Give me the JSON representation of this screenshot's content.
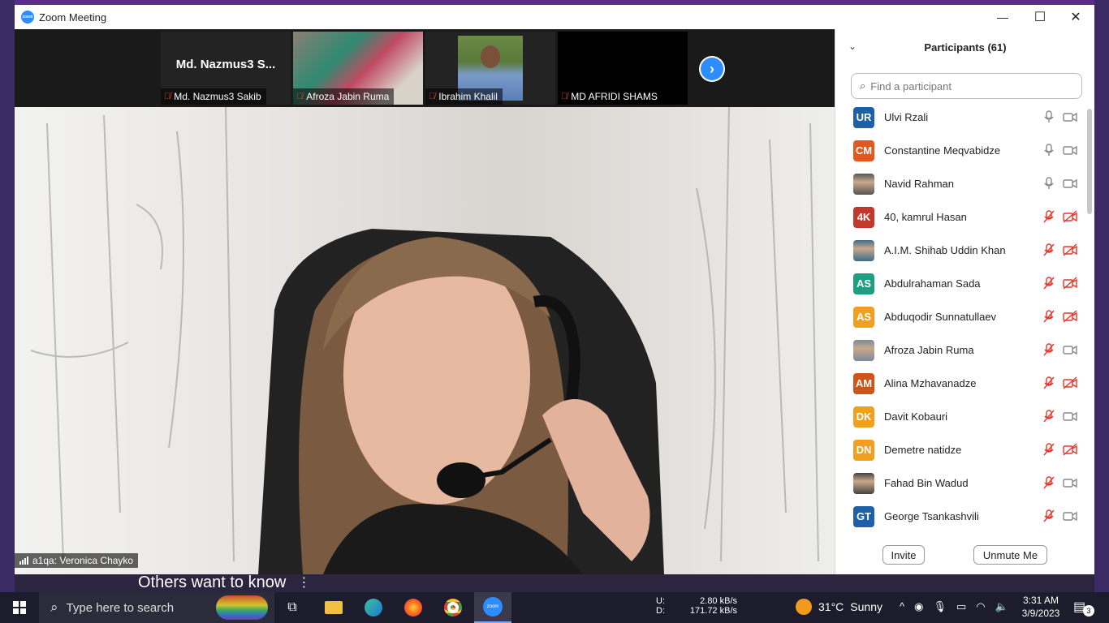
{
  "window": {
    "title": "Zoom Meeting",
    "controls": {
      "minimize": "—",
      "maximize": "☐",
      "close": "✕"
    }
  },
  "thumbnails": [
    {
      "name": "Md. Nazmus3 Sakib",
      "big_name": "Md. Nazmus3  S...",
      "muted": true
    },
    {
      "name": "Afroza Jabin Ruma",
      "muted": true
    },
    {
      "name": "Ibrahim Khalil",
      "muted": true
    },
    {
      "name": "MD AFRIDI SHAMS",
      "muted": true
    }
  ],
  "main_speaker": {
    "label": "a1qa: Veronica Chayko"
  },
  "participants_panel": {
    "title": "Participants (61)",
    "search_placeholder": "Find a participant",
    "participants": [
      {
        "initials": "UR",
        "name": "Ulvi Rzali",
        "color": "#1d5fa8",
        "mic": "on",
        "video": "on"
      },
      {
        "initials": "CM",
        "name": "Constantine Meqvabidze",
        "color": "#e05a1e",
        "mic": "on",
        "video": "on"
      },
      {
        "initials": "",
        "name": "Navid Rahman",
        "color": "#555555",
        "mic": "on",
        "video": "on",
        "photo": true
      },
      {
        "initials": "4K",
        "name": "40, kamrul Hasan",
        "color": "#c23a2b",
        "mic": "muted",
        "video": "off"
      },
      {
        "initials": "",
        "name": "A.I.M. Shihab Uddin Khan",
        "color": "#3a6b8c",
        "mic": "muted",
        "video": "off",
        "photo": true
      },
      {
        "initials": "AS",
        "name": "Abdulrahaman Sada",
        "color": "#1f9e84",
        "mic": "muted",
        "video": "off"
      },
      {
        "initials": "AS",
        "name": "Abduqodir Sunnatullaev",
        "color": "#f0a01e",
        "mic": "muted",
        "video": "off"
      },
      {
        "initials": "",
        "name": "Afroza Jabin Ruma",
        "color": "#7a8a9a",
        "mic": "muted",
        "video": "on",
        "photo": true
      },
      {
        "initials": "AM",
        "name": "Alina Mzhavanadze",
        "color": "#d0541a",
        "mic": "muted",
        "video": "off"
      },
      {
        "initials": "DK",
        "name": "Davit Kobauri",
        "color": "#f0a01e",
        "mic": "muted",
        "video": "on"
      },
      {
        "initials": "DN",
        "name": "Demetre natidze",
        "color": "#f0a01e",
        "mic": "muted",
        "video": "off"
      },
      {
        "initials": "",
        "name": "Fahad Bin Wadud",
        "color": "#444444",
        "mic": "muted",
        "video": "on",
        "photo": true
      },
      {
        "initials": "GT",
        "name": "George Tsankashvili",
        "color": "#1d5fa8",
        "mic": "muted",
        "video": "on"
      }
    ],
    "invite_label": "Invite",
    "unmute_label": "Unmute Me"
  },
  "news": {
    "text": "Others want to know",
    "menu": "⋮"
  },
  "taskbar": {
    "search_placeholder": "Type here to search",
    "net_up_label": "U:",
    "net_up": "2.80 kB/s",
    "net_down_label": "D:",
    "net_down": "171.72 kB/s",
    "weather_temp": "31°C",
    "weather_desc": "Sunny",
    "time": "3:31 AM",
    "date": "3/9/2023",
    "notification_count": "3"
  },
  "colors": {
    "zoom_blue": "#2d8cff",
    "muted_red": "#e5372b"
  }
}
